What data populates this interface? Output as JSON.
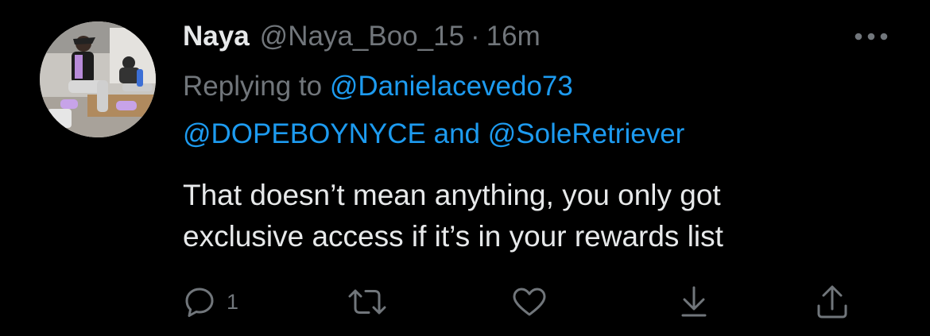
{
  "tweet": {
    "display_name": "Naya",
    "handle": "@Naya_Boo_15",
    "separator": "·",
    "time": "16m",
    "reply_prefix": "Replying to",
    "reply_mention_1": "@Danielacevedo73",
    "reply_mention_2": "@DOPEBOYNYCE",
    "reply_conjunction": "and",
    "reply_mention_3": "@SoleRetriever",
    "text_line_1": "That doesn’t mean anything, you only got",
    "text_line_2": "exclusive access if it’s in your rewards list"
  },
  "actions": {
    "reply_count": "1",
    "reply_icon": "reply-icon",
    "retweet_icon": "retweet-icon",
    "like_icon": "heart-icon",
    "bookmark_icon": "download-icon",
    "share_icon": "share-icon",
    "more_icon": "more-dots-icon"
  },
  "colors": {
    "background": "#000000",
    "text_primary": "#e7e9ea",
    "text_secondary": "#71767b",
    "link": "#1d9bf0"
  }
}
